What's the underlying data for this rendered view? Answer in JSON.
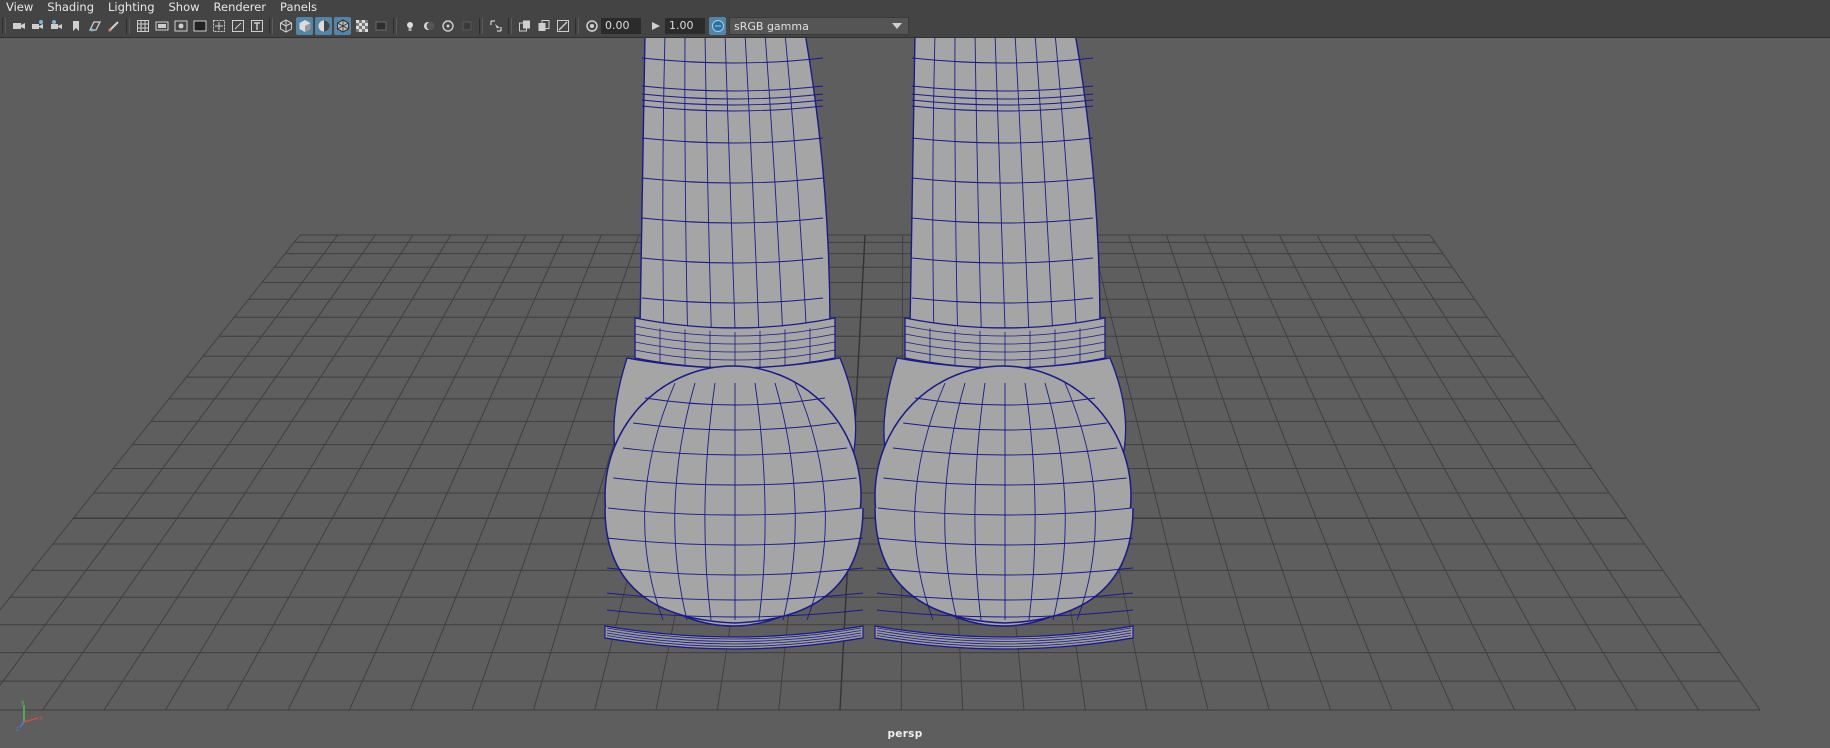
{
  "menu": [
    "View",
    "Shading",
    "Lighting",
    "Show",
    "Renderer",
    "Panels"
  ],
  "toolbar": {
    "exposure_value": "0.00",
    "gamma_value": "1.00",
    "color_space": "sRGB gamma"
  },
  "viewport": {
    "camera": "persp"
  },
  "colors": {
    "menubar_bg": "#444444",
    "viewport_bg": "#5e5e5e",
    "wireframe": "#1a1a8a",
    "mesh_fill": "#a5a5a5",
    "active_icon": "#5285a6"
  },
  "icons": [
    "camera-select-icon",
    "camera-attr-icon",
    "bookmark-icon",
    "image-plane-icon",
    "grid-icon",
    "film-gate-icon",
    "resolution-gate-icon",
    "gate-mask-icon",
    "field-chart-icon",
    "safe-action-icon",
    "safe-title-icon",
    "wireframe-icon",
    "smooth-shade-icon",
    "default-material-icon",
    "xray-icon",
    "textured-icon",
    "use-all-lights-icon",
    "shadows-icon",
    "screen-space-ao-icon",
    "motion-blur-icon",
    "anti-aliasing-icon",
    "depth-of-field-icon",
    "isolate-select-icon",
    "xray-joints-icon",
    "xray-active-icon",
    "backface-culling-icon",
    "exposure-icon",
    "gamma-icon",
    "color-management-icon",
    "dropdown-arrow-icon"
  ]
}
